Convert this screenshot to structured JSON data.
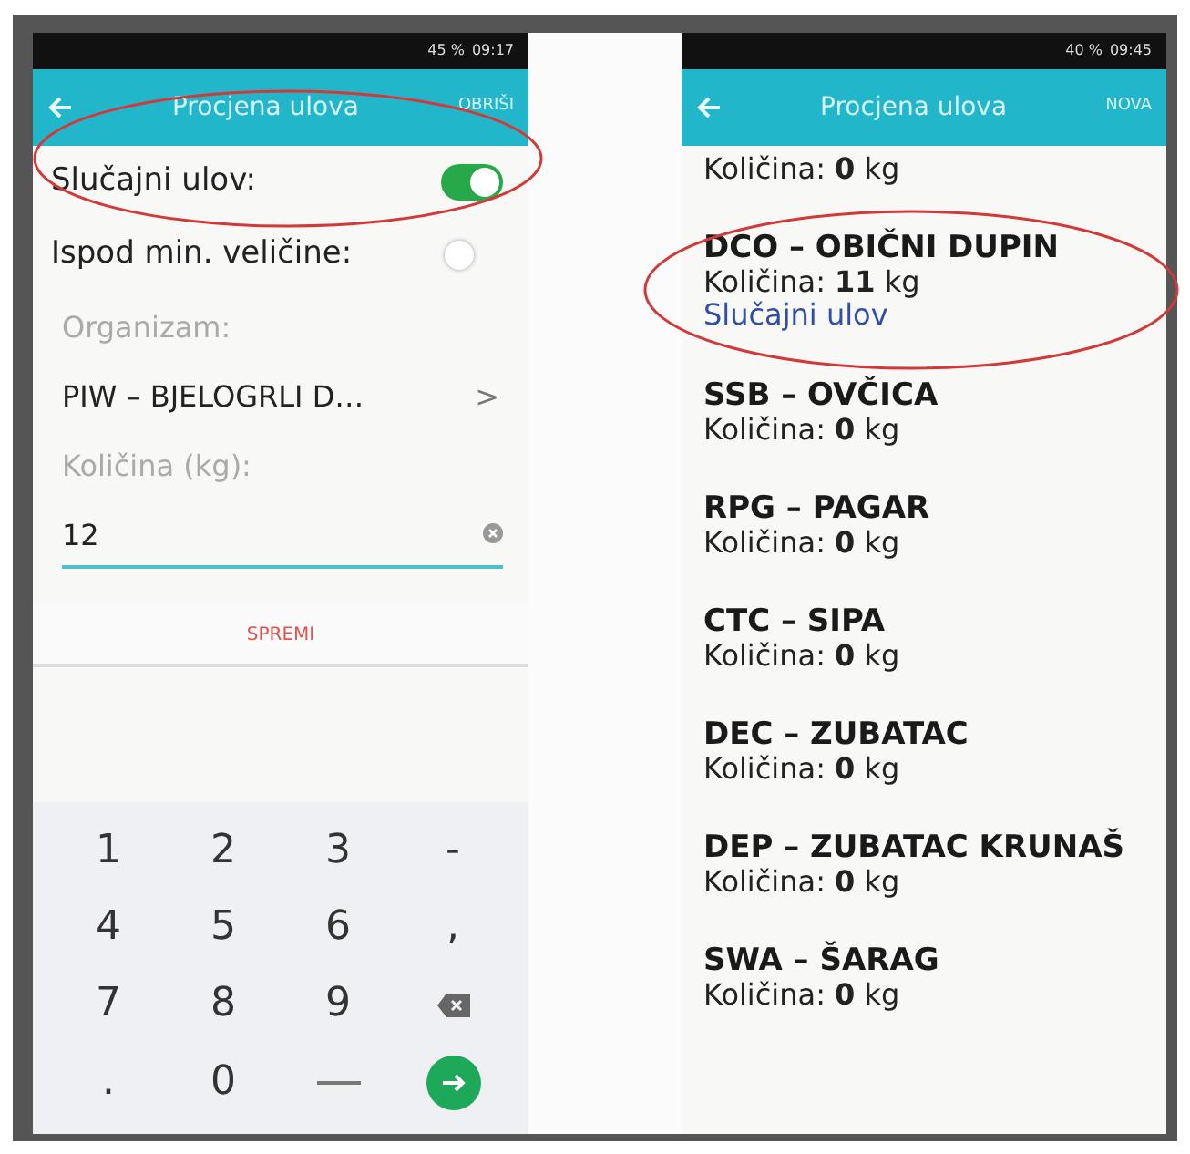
{
  "left_screen": {
    "status_bar": {
      "battery": "45 %",
      "time": "09:17"
    },
    "header": {
      "title": "Procjena ulova",
      "action": "OBRIŠI"
    },
    "switches": [
      {
        "label": "Slučajni ulov:",
        "on": true
      },
      {
        "label": "Ispod min. veličine:",
        "on": false
      }
    ],
    "organism": {
      "label": "Organizam:",
      "value": "PIW – BJELOGRLI D…",
      "chevron": ">"
    },
    "quantity": {
      "label": "Količina (kg):",
      "value": "12"
    },
    "save_button": "SPREMI",
    "keyboard": [
      {
        "kind": "key",
        "label": "1"
      },
      {
        "kind": "key",
        "label": "2"
      },
      {
        "kind": "key",
        "label": "3"
      },
      {
        "kind": "key",
        "label": "-"
      },
      {
        "kind": "key",
        "label": "4"
      },
      {
        "kind": "key",
        "label": "5"
      },
      {
        "kind": "key",
        "label": "6"
      },
      {
        "kind": "key",
        "label": ","
      },
      {
        "kind": "key",
        "label": "7"
      },
      {
        "kind": "key",
        "label": "8"
      },
      {
        "kind": "key",
        "label": "9"
      },
      {
        "kind": "backspace"
      },
      {
        "kind": "key",
        "label": "."
      },
      {
        "kind": "key",
        "label": "0"
      },
      {
        "kind": "space"
      },
      {
        "kind": "enter"
      }
    ]
  },
  "right_screen": {
    "status_bar": {
      "battery": "40 %",
      "time": "09:45"
    },
    "header": {
      "title": "Procjena ulova",
      "action": "NOVA"
    },
    "items": [
      {
        "quantity": "Količina: **0** kg"
      },
      {
        "title": "DCO – OBIČNI DUPIN",
        "quantity": "Količina: **11** kg",
        "note": "Slučajni ulov"
      },
      {
        "title": "SSB – OVČICA",
        "quantity": "Količina: **0** kg"
      },
      {
        "title": "RPG – PAGAR",
        "quantity": "Količina: **0** kg"
      },
      {
        "title": "CTC – SIPA",
        "quantity": "Količina: **0** kg"
      },
      {
        "title": "DEC – ZUBATAC",
        "quantity": "Količina: **0** kg"
      },
      {
        "title": "DEP – ZUBATAC KRUNAŠ",
        "quantity": "Količina: **0** kg"
      },
      {
        "title": "SWA – ŠARAG",
        "quantity": "Količina: **0** kg"
      }
    ]
  }
}
